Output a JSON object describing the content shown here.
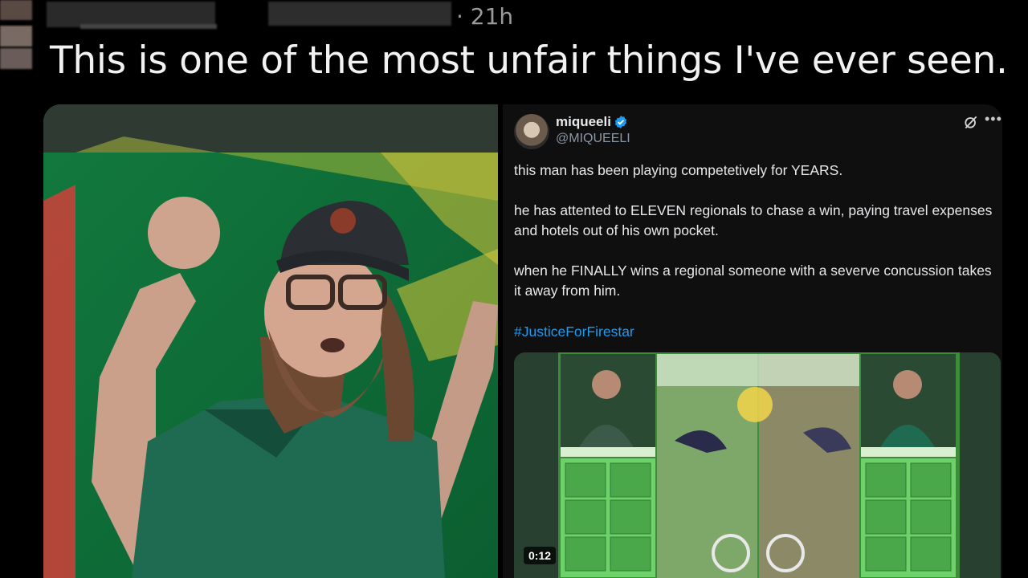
{
  "header": {
    "timestamp": "· 21h",
    "headline": "This is one of the most unfair things I've ever seen."
  },
  "embedded_post": {
    "author_name": "miqueeli",
    "author_handle": "@MIQUEELI",
    "paragraphs": [
      "this man has been playing competetively for YEARS.",
      "he has attented to ELEVEN regionals to chase a win, paying travel expenses and hotels out of his own pocket.",
      "when he FINALLY wins a regional someone with a severve concussion takes it away from him."
    ],
    "hashtag": "#JusticeForFirestar",
    "video": {
      "duration": "0:12"
    }
  },
  "icons": {
    "verified": "verified-badge-icon",
    "grok": "grok-icon",
    "more": "more-options-icon"
  },
  "colors": {
    "background": "#000000",
    "link": "#1d9bf0",
    "verified": "#1d9bf0",
    "embed_bg": "#0f0f10"
  }
}
